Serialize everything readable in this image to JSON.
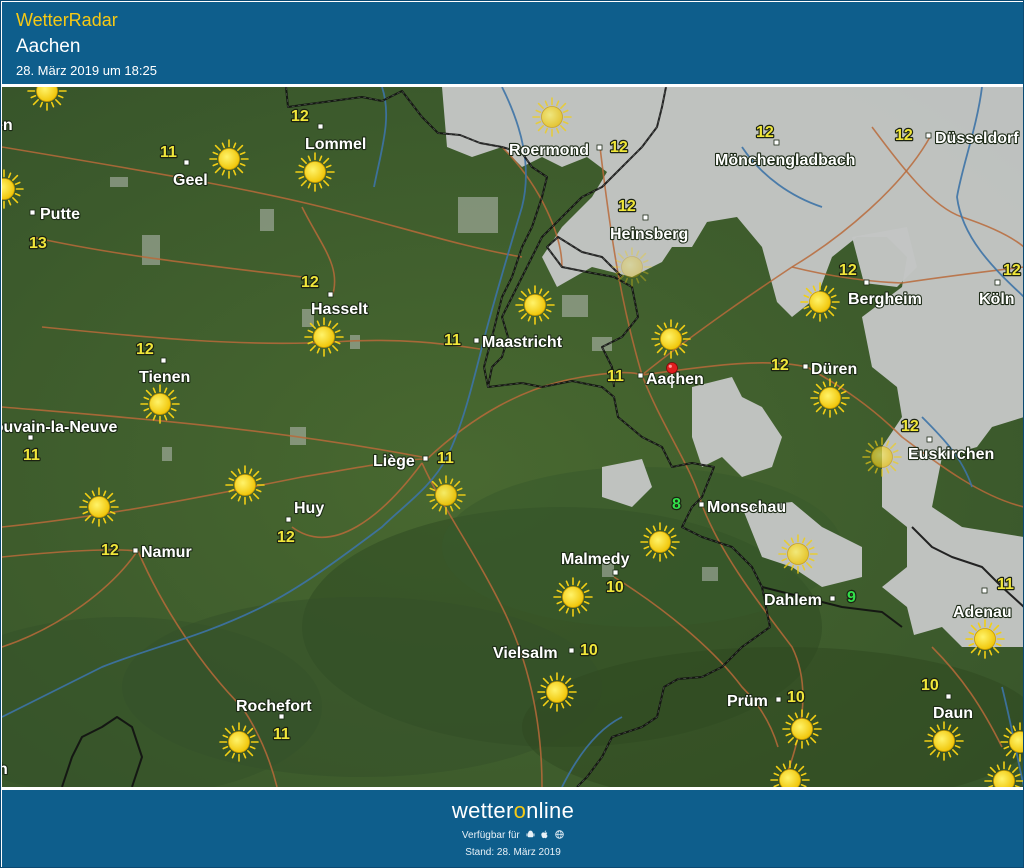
{
  "header": {
    "brand": "WetterRadar",
    "location": "Aachen",
    "timestamp": "28. März 2019 um 18:25"
  },
  "map": {
    "colors": {
      "terrain": "#3f5e2a",
      "cloud": "#c3c5c4",
      "road": "#b96a3a",
      "river": "#3d73a6",
      "border": "#111111",
      "temp_default": "#f0e63a",
      "temp_cool": "#32e04a"
    },
    "cities": [
      {
        "name": "Lommel"
      },
      {
        "name": "Geel"
      },
      {
        "name": "Putte"
      },
      {
        "name": "Roermond"
      },
      {
        "name": "Mönchengladbach"
      },
      {
        "name": "Düsseldorf"
      },
      {
        "name": "Heinsberg"
      },
      {
        "name": "Hasselt"
      },
      {
        "name": "Maastricht"
      },
      {
        "name": "Bergheim"
      },
      {
        "name": "Köln"
      },
      {
        "name": "Tienen"
      },
      {
        "name": "Aachen"
      },
      {
        "name": "Düren"
      },
      {
        "name": "Louvain-la-Neuve"
      },
      {
        "name": "Euskirchen"
      },
      {
        "name": "Liège"
      },
      {
        "name": "Huy"
      },
      {
        "name": "Monschau"
      },
      {
        "name": "Namur"
      },
      {
        "name": "Malmedy"
      },
      {
        "name": "Dahlem"
      },
      {
        "name": "Adenau"
      },
      {
        "name": "Vielsalm"
      },
      {
        "name": "Prüm"
      },
      {
        "name": "Daun"
      },
      {
        "name": "Rochefort"
      }
    ],
    "temperatures": [
      {
        "value": "12",
        "near": "Lommel"
      },
      {
        "value": "11",
        "near": "Geel"
      },
      {
        "value": "13",
        "near": "Putte"
      },
      {
        "value": "12",
        "near": "Roermond"
      },
      {
        "value": "12",
        "near": "Mönchengladbach"
      },
      {
        "value": "12",
        "near": "Düsseldorf"
      },
      {
        "value": "12",
        "near": "Heinsberg"
      },
      {
        "value": "12",
        "near": "Hasselt"
      },
      {
        "value": "11",
        "near": "Maastricht"
      },
      {
        "value": "12",
        "near": "Bergheim"
      },
      {
        "value": "12",
        "near": "Köln"
      },
      {
        "value": "12",
        "near": "Tienen"
      },
      {
        "value": "11",
        "near": "Aachen"
      },
      {
        "value": "12",
        "near": "Düren"
      },
      {
        "value": "11",
        "near": "Louvain-la-Neuve"
      },
      {
        "value": "12",
        "near": "Euskirchen"
      },
      {
        "value": "11",
        "near": "Liège"
      },
      {
        "value": "12",
        "near": "Huy"
      },
      {
        "value": "8",
        "near": "Monschau",
        "cool": true
      },
      {
        "value": "12",
        "near": "Namur"
      },
      {
        "value": "10",
        "near": "Malmedy"
      },
      {
        "value": "9",
        "near": "Dahlem",
        "cool": true
      },
      {
        "value": "11",
        "near": "Adenau"
      },
      {
        "value": "10",
        "near": "Vielsalm"
      },
      {
        "value": "10",
        "near": "Prüm"
      },
      {
        "value": "10",
        "near": "Daun"
      },
      {
        "value": "11",
        "near": "Rochefort"
      }
    ],
    "weather_icon": "sun-icon",
    "marker_icon": "location-pin-icon"
  },
  "footer": {
    "logo_pre": "wetter",
    "logo_o": "o",
    "logo_post": "nline",
    "availability": "Verfügbar für",
    "platforms": [
      "android-icon",
      "apple-icon",
      "web-icon"
    ],
    "stand": "Stand: 28. März 2019"
  }
}
